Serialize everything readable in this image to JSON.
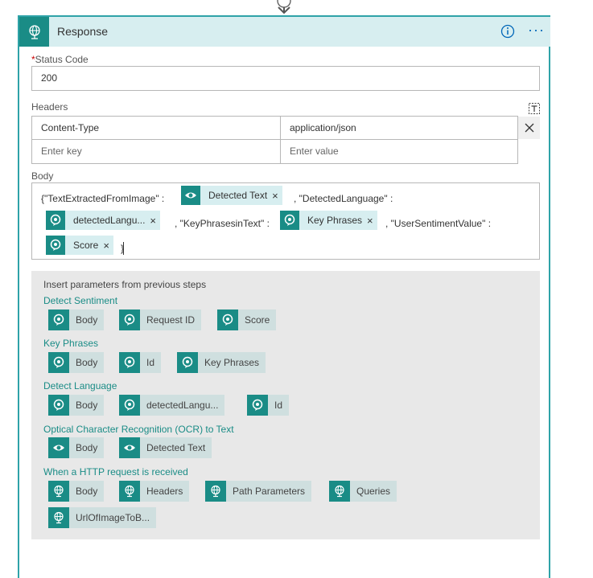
{
  "card": {
    "title": "Response",
    "info_icon": "info-icon",
    "more_icon": "ellipsis-icon",
    "more_label": "···"
  },
  "status": {
    "required_mark": "*",
    "label": "Status Code",
    "value": "200"
  },
  "headers": {
    "label": "Headers",
    "rows": [
      {
        "key": "Content-Type",
        "value": "application/json"
      },
      {
        "key_placeholder": "Enter key",
        "value_placeholder": "Enter value"
      }
    ]
  },
  "body": {
    "label": "Body",
    "text1": "{\"TextExtractedFromImage\" :",
    "token1": "Detected Text",
    "text2": ", \"DetectedLanguage\" :",
    "token2": "detectedLangu...",
    "text3": ", \"KeyPhrasesinText\" :",
    "token3": "Key Phrases",
    "text4": ", \"UserSentimentValue\" :",
    "token4": "Score",
    "text5": "}",
    "remove_glyph": "×"
  },
  "params": {
    "title": "Insert parameters from previous steps",
    "groups": [
      {
        "name": "Detect Sentiment",
        "chips": [
          "Body",
          "Request ID",
          "Score"
        ]
      },
      {
        "name": "Key Phrases",
        "chips": [
          "Body",
          "Id",
          "Key Phrases"
        ]
      },
      {
        "name": "Detect Language",
        "chips": [
          "Body",
          "detectedLangu...",
          "Id"
        ]
      },
      {
        "name": "Optical Character Recognition (OCR) to Text",
        "chips": [
          "Body",
          "Detected Text"
        ]
      },
      {
        "name": "When a HTTP request is received",
        "chips": [
          "Body",
          "Headers",
          "Path Parameters",
          "Queries",
          "UrlOfImageToB..."
        ]
      }
    ]
  },
  "colors": {
    "accent": "#1a8c86",
    "header_bg": "#d7eef0",
    "border": "#2fa3a8",
    "link": "#0066b8"
  }
}
